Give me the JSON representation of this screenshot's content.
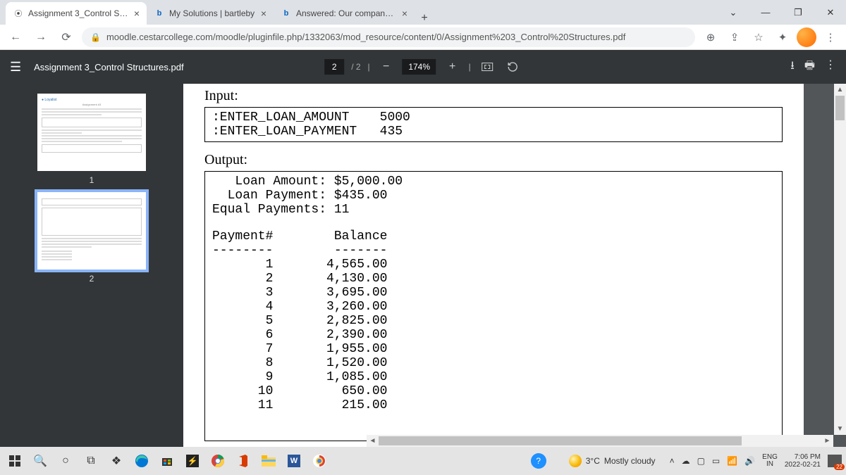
{
  "tabs": [
    {
      "title": "Assignment 3_Control Structures",
      "fav": "⦿",
      "active": true
    },
    {
      "title": "My Solutions | bartleby",
      "fav": "b",
      "active": false
    },
    {
      "title": "Answered: Our company provide",
      "fav": "b",
      "active": false
    }
  ],
  "url": "moodle.cestarcollege.com/moodle/pluginfile.php/1332063/mod_resource/content/0/Assignment%203_Control%20Structures.pdf",
  "pdf": {
    "docname": "Assignment 3_Control Structures.pdf",
    "page_current": "2",
    "page_total": "/ 2",
    "zoom": "174%"
  },
  "thumbs": [
    "1",
    "2"
  ],
  "doc": {
    "input_label": "Input:",
    "input_lines": ":ENTER_LOAN_AMOUNT    5000\n:ENTER_LOAN_PAYMENT   435",
    "output_label": "Output:",
    "summary": "   Loan Amount: $5,000.00\n  Loan Payment: $435.00\nEqual Payments: 11",
    "header": "Payment#        Balance\n--------        -------",
    "rows": "       1       4,565.00\n       2       4,130.00\n       3       3,695.00\n       4       3,260.00\n       5       2,825.00\n       6       2,390.00\n       7       1,955.00\n       8       1,520.00\n       9       1,085.00\n      10         650.00\n      11         215.00"
  },
  "weather": {
    "temp": "3°C",
    "desc": "Mostly cloudy"
  },
  "lang": {
    "top": "ENG",
    "bot": "IN"
  },
  "clock": {
    "time": "7:06 PM",
    "date": "2022-02-21"
  },
  "notif_count": "22"
}
